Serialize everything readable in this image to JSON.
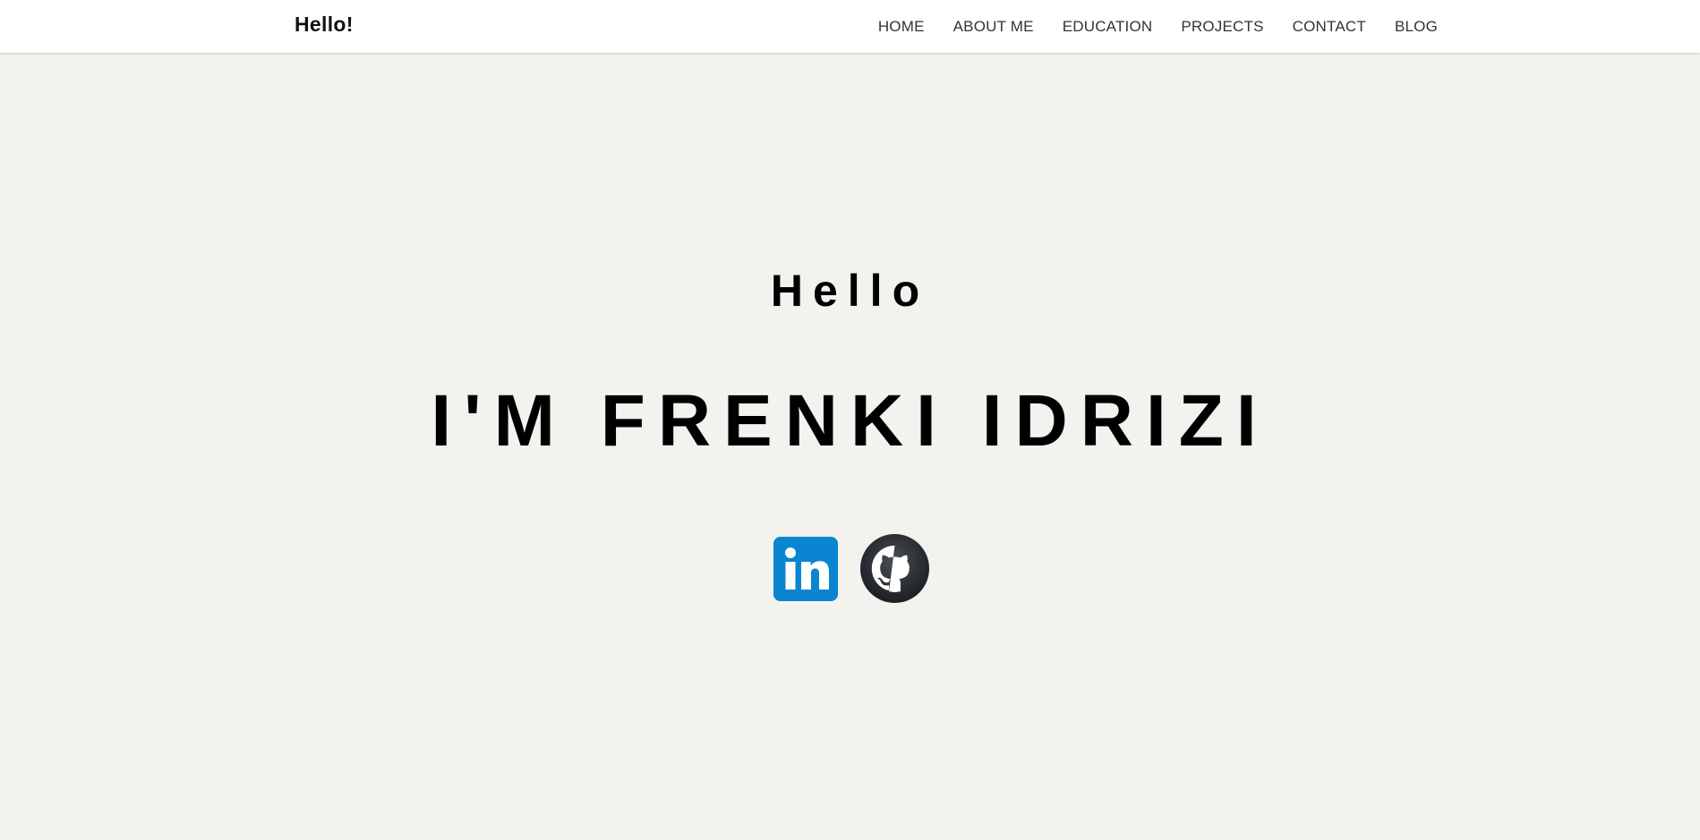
{
  "brand": {
    "label": "Hello!"
  },
  "nav": {
    "items": [
      {
        "label": "HOME"
      },
      {
        "label": "ABOUT ME"
      },
      {
        "label": "EDUCATION"
      },
      {
        "label": "PROJECTS"
      },
      {
        "label": "CONTACT"
      },
      {
        "label": "BLOG"
      }
    ]
  },
  "hero": {
    "greeting": "Hello",
    "headline": "I'M FRENKI IDRIZI"
  },
  "socials": [
    {
      "icon": "linkedin-icon",
      "color": "#0a85d1"
    },
    {
      "icon": "github-icon",
      "color": "#24292e"
    }
  ],
  "colors": {
    "background": "#f3f2ee",
    "navbar": "#ffffff",
    "text": "#000000"
  }
}
